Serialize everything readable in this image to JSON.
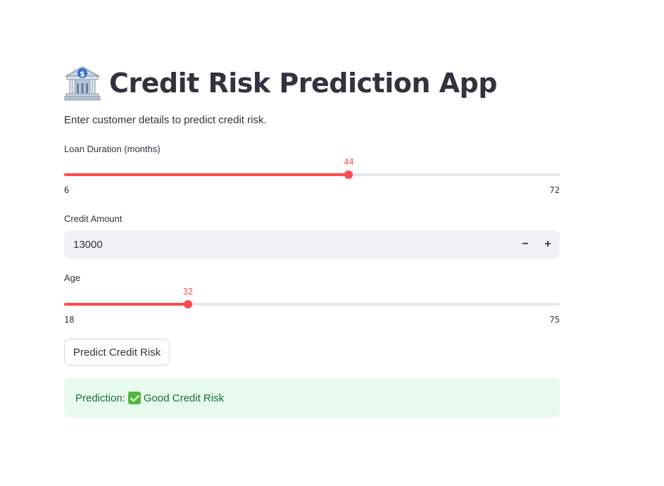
{
  "app": {
    "title": "Credit Risk Prediction App",
    "title_icon": "bank-icon",
    "subtitle": "Enter customer details to predict credit risk."
  },
  "loan_duration": {
    "label": "Loan Duration (months)",
    "value": 44,
    "min": 6,
    "max": 72
  },
  "credit_amount": {
    "label": "Credit Amount",
    "value": "13000",
    "decrement_label": "−",
    "increment_label": "+"
  },
  "age": {
    "label": "Age",
    "value": 32,
    "min": 18,
    "max": 75
  },
  "predict_button": {
    "label": "Predict Credit Risk"
  },
  "result": {
    "prefix": "Prediction:",
    "status_icon": "check-icon",
    "text": "Good Credit Risk"
  },
  "colors": {
    "accent": "#ff4b4b",
    "success_bg": "#e8f9ee",
    "success_text": "#177233"
  }
}
